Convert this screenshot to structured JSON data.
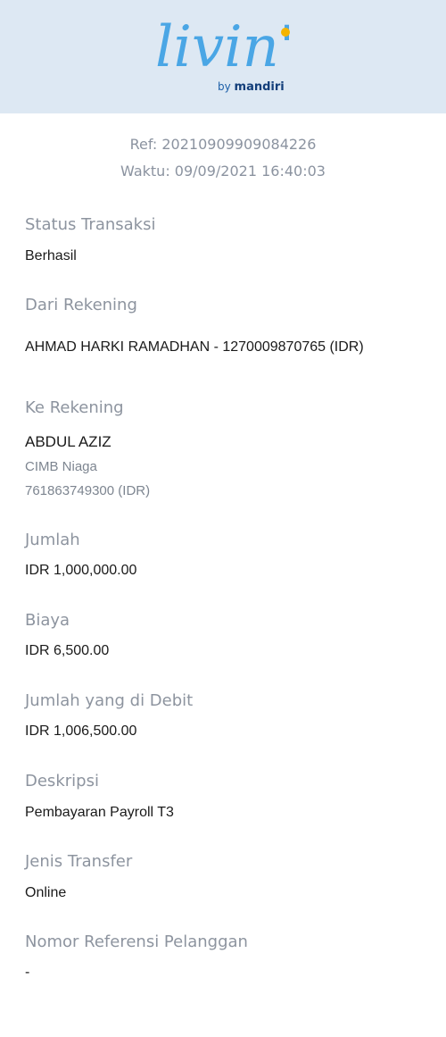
{
  "brand": {
    "logo_text": "livin'",
    "by_text": "by",
    "bank": "mandiri",
    "logo_color": "#4aa6e5",
    "accent_color": "#f4b400"
  },
  "meta": {
    "ref": "Ref: 20210909909084226",
    "time": "Waktu: 09/09/2021 16:40:03"
  },
  "fields": {
    "status": {
      "label": "Status Transaksi",
      "value": "Berhasil"
    },
    "from": {
      "label": "Dari Rekening",
      "value": "AHMAD HARKI RAMADHAN - 1270009870765 (IDR)"
    },
    "to": {
      "label": "Ke Rekening",
      "name": "ABDUL AZIZ",
      "bank": "CIMB Niaga",
      "account": "761863749300 (IDR)"
    },
    "amount": {
      "label": "Jumlah",
      "value": "IDR 1,000,000.00"
    },
    "fee": {
      "label": "Biaya",
      "value": "IDR 6,500.00"
    },
    "debit": {
      "label": "Jumlah yang di Debit",
      "value": "IDR 1,006,500.00"
    },
    "description": {
      "label": "Deskripsi",
      "value": "Pembayaran Payroll T3"
    },
    "transfer_type": {
      "label": "Jenis Transfer",
      "value": "Online"
    },
    "customer_ref": {
      "label": "Nomor Referensi Pelanggan",
      "value": "-"
    }
  }
}
